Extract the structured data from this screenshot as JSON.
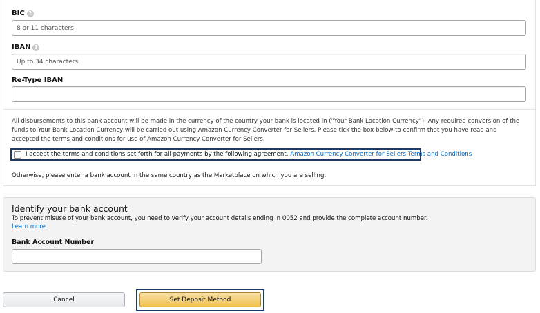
{
  "bic": {
    "label": "BIC",
    "help_icon": "question-circle-icon",
    "placeholder": "8 or 11 characters"
  },
  "iban": {
    "label": "IBAN",
    "help_icon": "question-circle-icon",
    "placeholder": "Up to 34 characters"
  },
  "retype_iban": {
    "label": "Re-Type IBAN",
    "value": ""
  },
  "currency_notice": {
    "text": "All disbursements to this bank account will be made in the currency of the country your bank is located in (\"Your Bank Location Currency\"). Any required conversion of the funds to Your Bank Location Currency will be carried out using Amazon Currency Converter for Sellers. Please tick the box below to confirm that you have read and accepted the terms and conditions for use of Amazon Currency Converter for Sellers.",
    "accept_label": "I accept the terms and conditions set forth for all payments by the following agreement.",
    "terms_link": "Amazon Currency Converter for Sellers Terms and Conditions",
    "accept_checked": false,
    "otherwise_text": "Otherwise, please enter a bank account in the same country as the Marketplace on which you are selling."
  },
  "identify": {
    "title": "Identify your bank account",
    "description": "To prevent misuse of your bank account, you need to verify your account details ending in 0052 and provide the complete account number.",
    "learn_more": "Learn more",
    "account_number_label": "Bank Account Number",
    "account_number_value": ""
  },
  "actions": {
    "cancel_label": "Cancel",
    "submit_label": "Set Deposit Method"
  },
  "colors": {
    "link": "#0066c0",
    "primary_button": "#f0c14b",
    "focus_outline": "#1b3a6b"
  }
}
